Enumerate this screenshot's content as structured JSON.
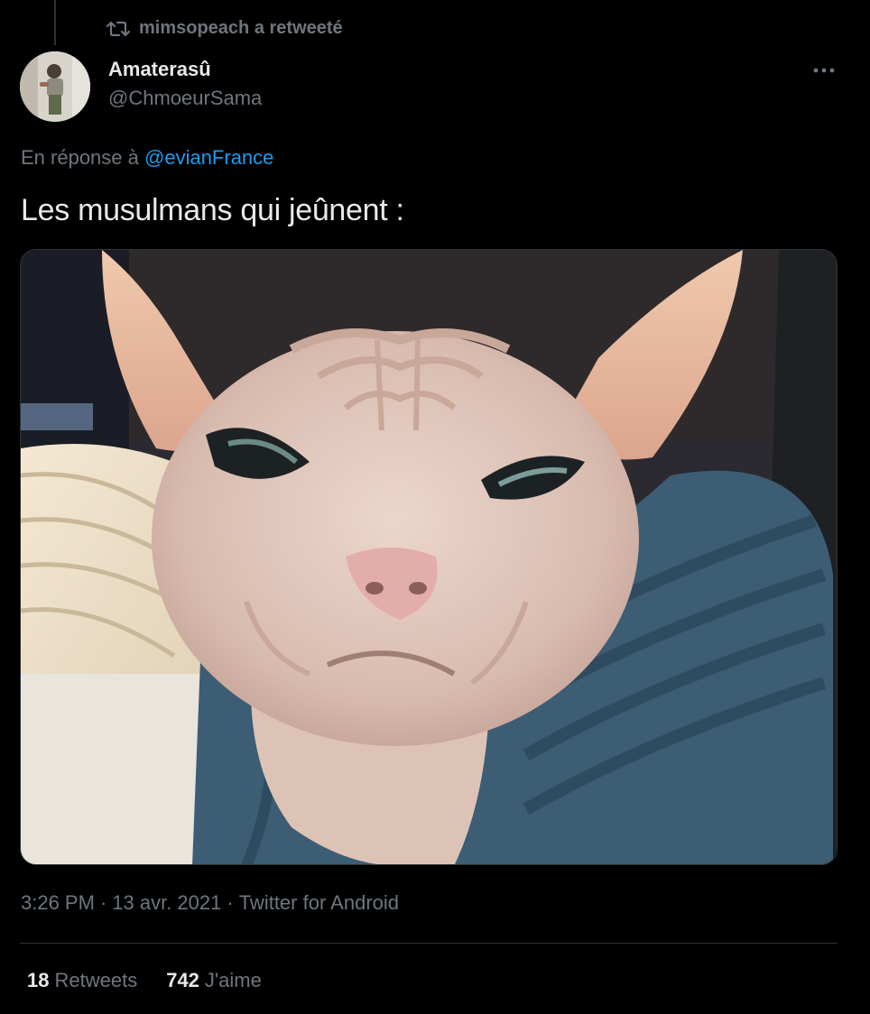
{
  "retweet_banner": {
    "text": "mimsopeach a retweeté",
    "icon": "retweet-icon"
  },
  "author": {
    "display_name": "Amaterasû",
    "handle": "@ChmoeurSama"
  },
  "reply": {
    "prefix": "En réponse à",
    "mention": "@evianFrance"
  },
  "tweet": {
    "text": "Les musulmans qui jeûnent :",
    "media_icon": "sphynx-cat-photo"
  },
  "meta": {
    "time": "3:26 PM",
    "date": "13 avr. 2021",
    "source": "Twitter for Android",
    "separator": "·"
  },
  "stats": {
    "retweets_count": "18",
    "retweets_label": "Retweets",
    "likes_count": "742",
    "likes_label": "J'aime"
  },
  "colors": {
    "background": "#000000",
    "text_primary": "#e7e9ea",
    "text_secondary": "#6e767d",
    "link": "#1d9bf0",
    "divider": "#2f3336"
  }
}
